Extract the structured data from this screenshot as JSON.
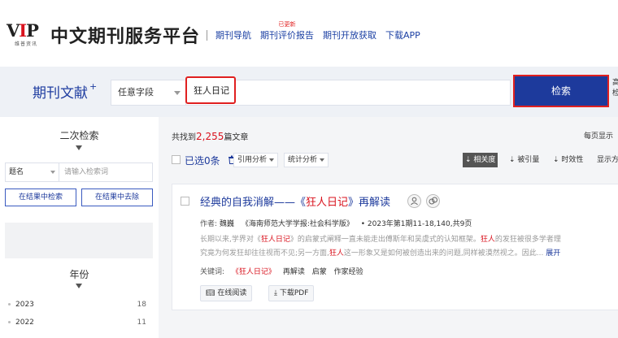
{
  "header": {
    "logo_mark": "VIP",
    "logo_sub": "维普资讯",
    "site_title": "中文期刊服务平台",
    "nav": [
      {
        "label": "期刊导航"
      },
      {
        "label": "期刊评价报告",
        "badge": "已更新"
      },
      {
        "label": "期刊开放获取"
      },
      {
        "label": "下载APP"
      }
    ]
  },
  "search": {
    "section_label": "期刊文献",
    "section_sup": "+",
    "field": "任意字段",
    "query": "狂人日记",
    "button": "检索",
    "extra": [
      "高",
      "检"
    ]
  },
  "sidebar": {
    "secondary_title": "二次检索",
    "field_select": "题名",
    "field_placeholder": "请输入检索词",
    "search_in_results": "在结果中检索",
    "exclude_from_results": "在结果中去除",
    "year_title": "年份",
    "years": [
      {
        "year": "2023",
        "count": "18"
      },
      {
        "year": "2022",
        "count": "11"
      }
    ]
  },
  "results": {
    "summary_prefix": "共找到",
    "total": "2,255",
    "summary_suffix": "篇文章",
    "per_page": "每页显示",
    "selected": "已选0条",
    "toolbar": {
      "citation": "引用分析",
      "stats": "统计分析",
      "sort_relevance": "相关度",
      "sort_citations": "被引量",
      "sort_timeliness": "时效性",
      "display": "显示方"
    },
    "card": {
      "title_before": "经典的自我消解——《",
      "title_hl": "狂人日记",
      "title_after": "》再解读",
      "author_label": "作者:",
      "author": "魏巍",
      "journal": "《海南师范大学学报:社会科学版》",
      "issue": "• 2023年第1期11-18,140,共9页",
      "abstract_line1": [
        "长期以来,学界对《",
        "狂人日记",
        "》的启蒙式阐释一直未能走出傅斯年和吴虞式的认知框架。",
        "狂人",
        "的发狂被很多学者理"
      ],
      "abstract_line2": [
        "究竟为何发狂却往往视而不见;另一方面,",
        "狂人",
        "这一形象又是如何被创造出来的问题,同样被漠然视之。因此...",
        " 展开"
      ],
      "keywords_label": "关键词:",
      "keywords": [
        "《狂人日记》",
        "再解读",
        "启蒙",
        "作家经验"
      ],
      "read_online": "在线阅读",
      "download_pdf": "下载PDF"
    }
  }
}
